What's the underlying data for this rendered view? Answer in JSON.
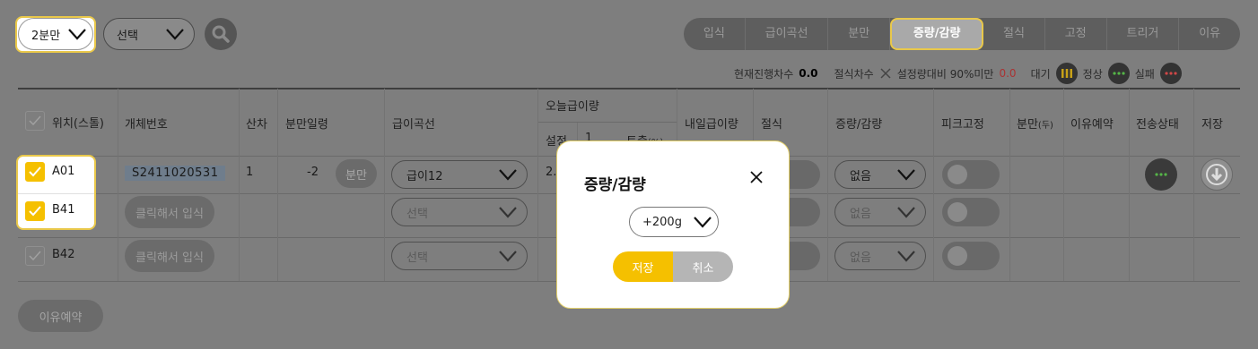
{
  "filters": {
    "division_select": "2분만",
    "option_select": "선택"
  },
  "tabs": [
    "입식",
    "급이곡선",
    "분만",
    "증량/감량",
    "절식",
    "고정",
    "트리거",
    "이유"
  ],
  "status": {
    "current_label": "현재진행차수",
    "current_value": "0.0",
    "fast_label": "절식차수",
    "ratio_label": "설정량대비 90%미만",
    "ratio_value": "0.0",
    "wait_label": "대기",
    "normal_label": "정상",
    "fail_label": "실패"
  },
  "table": {
    "headers": {
      "position": "위치(스톨)",
      "id": "개체번호",
      "parity": "산차",
      "days": "분만일령",
      "curve": "급이곡선",
      "today_group": "오늘급이량",
      "today_set": "설정",
      "today_1": "1",
      "today_out": "토출",
      "today_out_unit": "(%)",
      "tomorrow": "내일급이량",
      "fast": "절식",
      "adjust": "증량/감량",
      "peak": "피크고정",
      "farrow": "분만",
      "farrow_unit": "(두)",
      "wean": "이유예약",
      "transfer": "전송상태",
      "save": "저장"
    },
    "rows": [
      {
        "position": "A01",
        "id": "S2411020531",
        "parity": "1",
        "days": "-2",
        "farrow_btn": "분만",
        "curve": "급이12",
        "today_set": "2.",
        "adjust": "없음"
      },
      {
        "position": "B41",
        "id_btn": "클릭해서 입식",
        "curve": "선택",
        "adjust": "없음"
      },
      {
        "position": "B42",
        "id_btn": "클릭해서 입식",
        "curve": "선택",
        "adjust": "없음"
      }
    ]
  },
  "wean_button": "이유예약",
  "modal": {
    "title": "증량/감량",
    "select_value": "+200g",
    "save": "저장",
    "cancel": "취소"
  },
  "colors": {
    "accent": "#f5c000",
    "highlight_border": "#e9c84a",
    "normal": "#55b548",
    "fail": "#d04848"
  }
}
